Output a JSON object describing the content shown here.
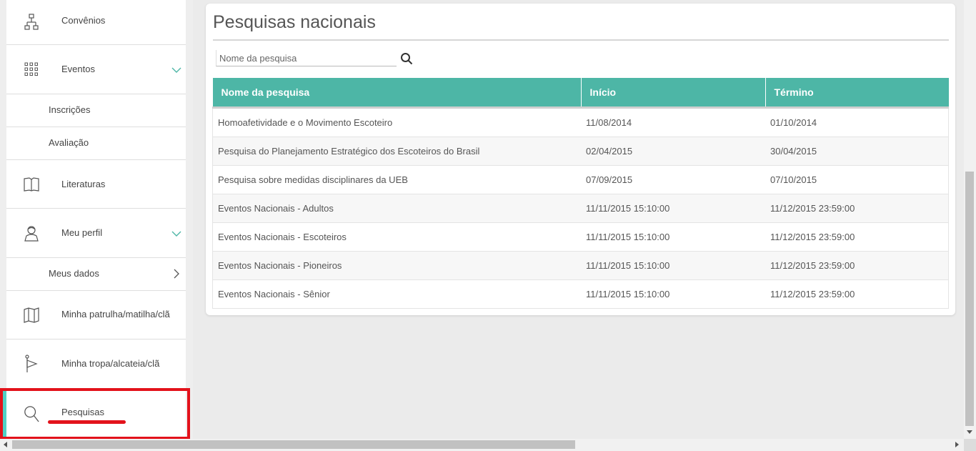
{
  "sidebar": {
    "items": [
      {
        "label": "Convênios",
        "icon": "org-chart-icon"
      },
      {
        "label": "Eventos",
        "icon": "grid-icon",
        "expanded": true
      },
      {
        "label": "Inscrições"
      },
      {
        "label": "Avaliação"
      },
      {
        "label": "Literaturas",
        "icon": "book-icon"
      },
      {
        "label": "Meu perfil",
        "icon": "user-icon",
        "expanded": true
      },
      {
        "label": "Meus dados"
      },
      {
        "label": "Minha  patrulha/matilha/clã",
        "icon": "map-icon"
      },
      {
        "label": "Minha  tropa/alcateia/clã",
        "icon": "flag-icon"
      },
      {
        "label": "Pesquisas",
        "icon": "search-icon",
        "active": true
      }
    ],
    "accent_color": "#4fd1c5",
    "highlight_color": "#e3121b"
  },
  "main": {
    "title": "Pesquisas nacionais",
    "search": {
      "placeholder": "Nome da pesquisa",
      "value": ""
    },
    "table": {
      "header_color": "#4db6a6",
      "columns": [
        "Nome da pesquisa",
        "Início",
        "Término"
      ],
      "rows": [
        [
          "Homoafetividade e o Movimento Escoteiro",
          "11/08/2014",
          "01/10/2014"
        ],
        [
          "Pesquisa do Planejamento Estratégico dos Escoteiros do Brasil",
          "02/04/2015",
          "30/04/2015"
        ],
        [
          "Pesquisa sobre medidas disciplinares da UEB",
          "07/09/2015",
          "07/10/2015"
        ],
        [
          "Eventos Nacionais - Adultos",
          "11/11/2015 15:10:00",
          "11/12/2015 23:59:00"
        ],
        [
          "Eventos Nacionais - Escoteiros",
          "11/11/2015 15:10:00",
          "11/12/2015 23:59:00"
        ],
        [
          "Eventos Nacionais - Pioneiros",
          "11/11/2015 15:10:00",
          "11/12/2015 23:59:00"
        ],
        [
          "Eventos Nacionais - Sênior",
          "11/11/2015 15:10:00",
          "11/12/2015 23:59:00"
        ]
      ]
    }
  }
}
